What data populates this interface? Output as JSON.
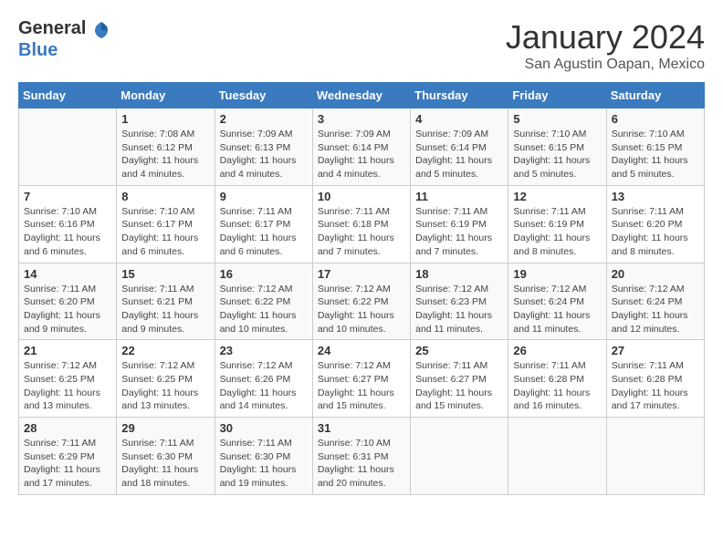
{
  "header": {
    "logo_general": "General",
    "logo_blue": "Blue",
    "month_title": "January 2024",
    "location": "San Agustin Oapan, Mexico"
  },
  "weekdays": [
    "Sunday",
    "Monday",
    "Tuesday",
    "Wednesday",
    "Thursday",
    "Friday",
    "Saturday"
  ],
  "weeks": [
    [
      {
        "day": "",
        "sunrise": "",
        "sunset": "",
        "daylight": ""
      },
      {
        "day": "1",
        "sunrise": "Sunrise: 7:08 AM",
        "sunset": "Sunset: 6:12 PM",
        "daylight": "Daylight: 11 hours and 4 minutes."
      },
      {
        "day": "2",
        "sunrise": "Sunrise: 7:09 AM",
        "sunset": "Sunset: 6:13 PM",
        "daylight": "Daylight: 11 hours and 4 minutes."
      },
      {
        "day": "3",
        "sunrise": "Sunrise: 7:09 AM",
        "sunset": "Sunset: 6:14 PM",
        "daylight": "Daylight: 11 hours and 4 minutes."
      },
      {
        "day": "4",
        "sunrise": "Sunrise: 7:09 AM",
        "sunset": "Sunset: 6:14 PM",
        "daylight": "Daylight: 11 hours and 5 minutes."
      },
      {
        "day": "5",
        "sunrise": "Sunrise: 7:10 AM",
        "sunset": "Sunset: 6:15 PM",
        "daylight": "Daylight: 11 hours and 5 minutes."
      },
      {
        "day": "6",
        "sunrise": "Sunrise: 7:10 AM",
        "sunset": "Sunset: 6:15 PM",
        "daylight": "Daylight: 11 hours and 5 minutes."
      }
    ],
    [
      {
        "day": "7",
        "sunrise": "Sunrise: 7:10 AM",
        "sunset": "Sunset: 6:16 PM",
        "daylight": "Daylight: 11 hours and 6 minutes."
      },
      {
        "day": "8",
        "sunrise": "Sunrise: 7:10 AM",
        "sunset": "Sunset: 6:17 PM",
        "daylight": "Daylight: 11 hours and 6 minutes."
      },
      {
        "day": "9",
        "sunrise": "Sunrise: 7:11 AM",
        "sunset": "Sunset: 6:17 PM",
        "daylight": "Daylight: 11 hours and 6 minutes."
      },
      {
        "day": "10",
        "sunrise": "Sunrise: 7:11 AM",
        "sunset": "Sunset: 6:18 PM",
        "daylight": "Daylight: 11 hours and 7 minutes."
      },
      {
        "day": "11",
        "sunrise": "Sunrise: 7:11 AM",
        "sunset": "Sunset: 6:19 PM",
        "daylight": "Daylight: 11 hours and 7 minutes."
      },
      {
        "day": "12",
        "sunrise": "Sunrise: 7:11 AM",
        "sunset": "Sunset: 6:19 PM",
        "daylight": "Daylight: 11 hours and 8 minutes."
      },
      {
        "day": "13",
        "sunrise": "Sunrise: 7:11 AM",
        "sunset": "Sunset: 6:20 PM",
        "daylight": "Daylight: 11 hours and 8 minutes."
      }
    ],
    [
      {
        "day": "14",
        "sunrise": "Sunrise: 7:11 AM",
        "sunset": "Sunset: 6:20 PM",
        "daylight": "Daylight: 11 hours and 9 minutes."
      },
      {
        "day": "15",
        "sunrise": "Sunrise: 7:11 AM",
        "sunset": "Sunset: 6:21 PM",
        "daylight": "Daylight: 11 hours and 9 minutes."
      },
      {
        "day": "16",
        "sunrise": "Sunrise: 7:12 AM",
        "sunset": "Sunset: 6:22 PM",
        "daylight": "Daylight: 11 hours and 10 minutes."
      },
      {
        "day": "17",
        "sunrise": "Sunrise: 7:12 AM",
        "sunset": "Sunset: 6:22 PM",
        "daylight": "Daylight: 11 hours and 10 minutes."
      },
      {
        "day": "18",
        "sunrise": "Sunrise: 7:12 AM",
        "sunset": "Sunset: 6:23 PM",
        "daylight": "Daylight: 11 hours and 11 minutes."
      },
      {
        "day": "19",
        "sunrise": "Sunrise: 7:12 AM",
        "sunset": "Sunset: 6:24 PM",
        "daylight": "Daylight: 11 hours and 11 minutes."
      },
      {
        "day": "20",
        "sunrise": "Sunrise: 7:12 AM",
        "sunset": "Sunset: 6:24 PM",
        "daylight": "Daylight: 11 hours and 12 minutes."
      }
    ],
    [
      {
        "day": "21",
        "sunrise": "Sunrise: 7:12 AM",
        "sunset": "Sunset: 6:25 PM",
        "daylight": "Daylight: 11 hours and 13 minutes."
      },
      {
        "day": "22",
        "sunrise": "Sunrise: 7:12 AM",
        "sunset": "Sunset: 6:25 PM",
        "daylight": "Daylight: 11 hours and 13 minutes."
      },
      {
        "day": "23",
        "sunrise": "Sunrise: 7:12 AM",
        "sunset": "Sunset: 6:26 PM",
        "daylight": "Daylight: 11 hours and 14 minutes."
      },
      {
        "day": "24",
        "sunrise": "Sunrise: 7:12 AM",
        "sunset": "Sunset: 6:27 PM",
        "daylight": "Daylight: 11 hours and 15 minutes."
      },
      {
        "day": "25",
        "sunrise": "Sunrise: 7:11 AM",
        "sunset": "Sunset: 6:27 PM",
        "daylight": "Daylight: 11 hours and 15 minutes."
      },
      {
        "day": "26",
        "sunrise": "Sunrise: 7:11 AM",
        "sunset": "Sunset: 6:28 PM",
        "daylight": "Daylight: 11 hours and 16 minutes."
      },
      {
        "day": "27",
        "sunrise": "Sunrise: 7:11 AM",
        "sunset": "Sunset: 6:28 PM",
        "daylight": "Daylight: 11 hours and 17 minutes."
      }
    ],
    [
      {
        "day": "28",
        "sunrise": "Sunrise: 7:11 AM",
        "sunset": "Sunset: 6:29 PM",
        "daylight": "Daylight: 11 hours and 17 minutes."
      },
      {
        "day": "29",
        "sunrise": "Sunrise: 7:11 AM",
        "sunset": "Sunset: 6:30 PM",
        "daylight": "Daylight: 11 hours and 18 minutes."
      },
      {
        "day": "30",
        "sunrise": "Sunrise: 7:11 AM",
        "sunset": "Sunset: 6:30 PM",
        "daylight": "Daylight: 11 hours and 19 minutes."
      },
      {
        "day": "31",
        "sunrise": "Sunrise: 7:10 AM",
        "sunset": "Sunset: 6:31 PM",
        "daylight": "Daylight: 11 hours and 20 minutes."
      },
      {
        "day": "",
        "sunrise": "",
        "sunset": "",
        "daylight": ""
      },
      {
        "day": "",
        "sunrise": "",
        "sunset": "",
        "daylight": ""
      },
      {
        "day": "",
        "sunrise": "",
        "sunset": "",
        "daylight": ""
      }
    ]
  ]
}
